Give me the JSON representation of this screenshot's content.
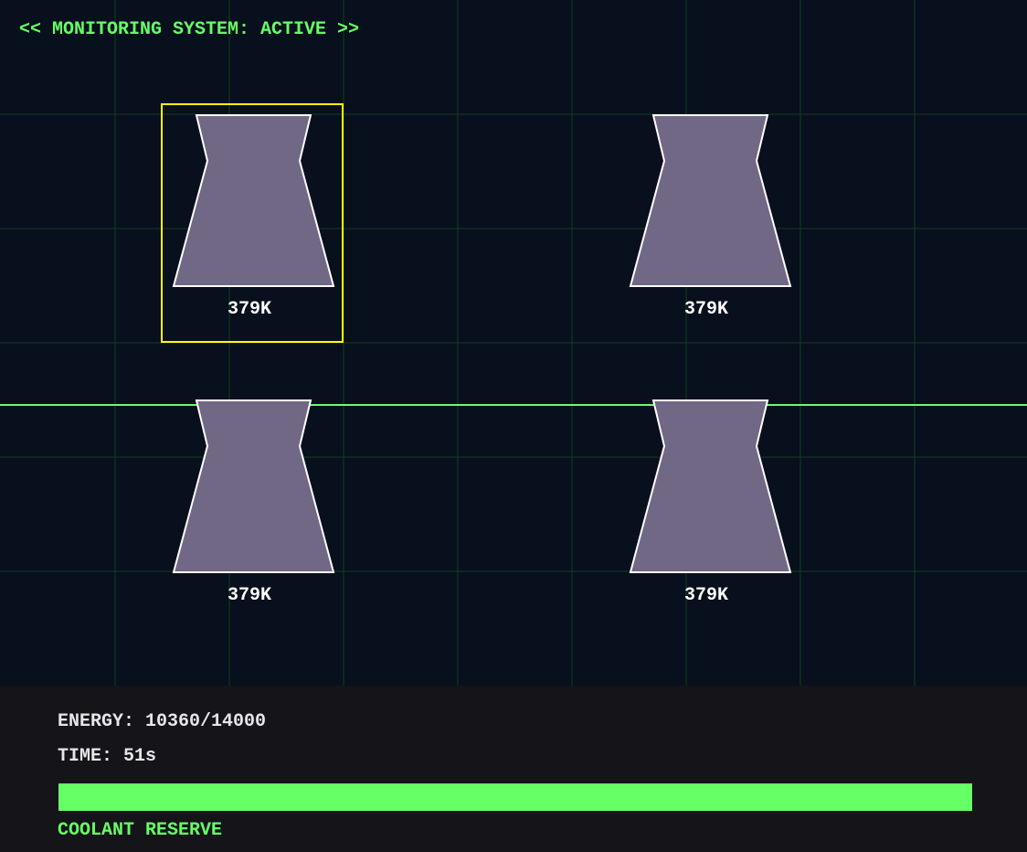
{
  "header": {
    "status": "<< MONITORING SYSTEM: ACTIVE >>"
  },
  "reactors": [
    {
      "label": "379K",
      "selected": true
    },
    {
      "label": "379K",
      "selected": false
    },
    {
      "label": "379K",
      "selected": false
    },
    {
      "label": "379K",
      "selected": false
    }
  ],
  "hud": {
    "energy_text": "ENERGY: 10360/14000",
    "time_text": "TIME: 51s",
    "coolant_label": "COOLANT RESERVE",
    "coolant_fraction": 1.0
  },
  "colors": {
    "background": "#07101c",
    "grid": "#163a24",
    "accent_green": "#66ff66",
    "tower_fill": "#716886",
    "tower_stroke": "#ffffff",
    "selection": "#ffff00",
    "hud_background": "#141419",
    "hud_text": "#e6e6e6"
  }
}
